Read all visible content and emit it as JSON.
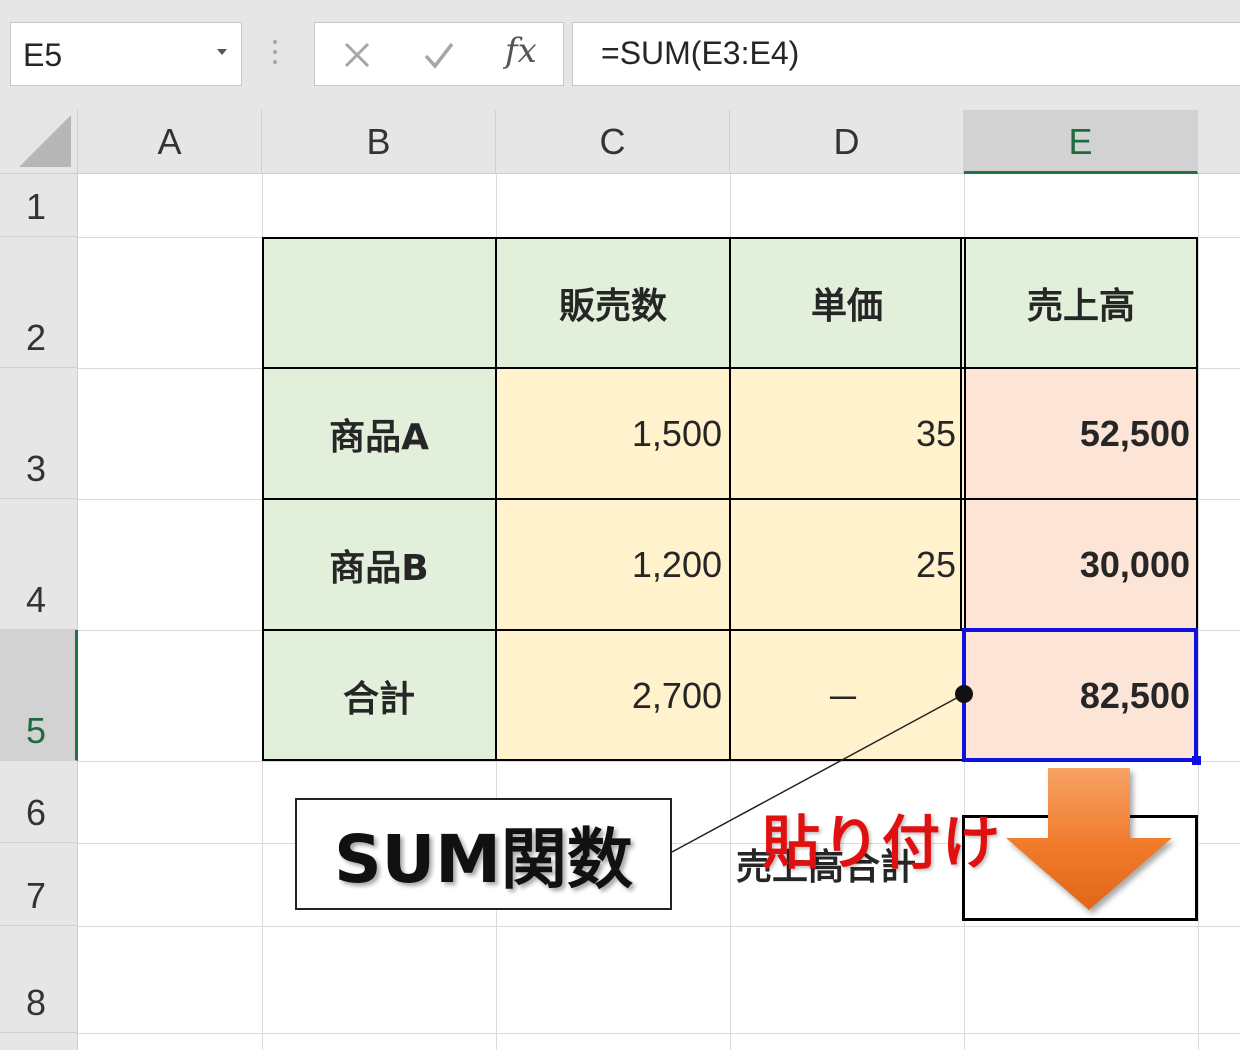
{
  "formula_bar": {
    "name_box": "E5",
    "cancel_icon": "x-icon",
    "enter_icon": "check-icon",
    "fx_label": "fx",
    "formula": "=SUM(E3:E4)"
  },
  "grid": {
    "selected_cell": "E5",
    "columns": [
      "A",
      "B",
      "C",
      "D",
      "E"
    ],
    "rows": [
      "1",
      "2",
      "3",
      "4",
      "5",
      "6",
      "7",
      "8"
    ]
  },
  "table": {
    "headers": [
      "販売数",
      "単価",
      "売上高"
    ],
    "rows": [
      {
        "label": "商品A",
        "qty": "1,500",
        "price": "35",
        "sales": "52,500"
      },
      {
        "label": "商品B",
        "qty": "1,200",
        "price": "25",
        "sales": "30,000"
      },
      {
        "label": "合計",
        "qty": "2,700",
        "price": "－",
        "sales": "82,500"
      }
    ],
    "total_sales_label": "売上高合計",
    "colors": {
      "header": "#e2efda",
      "input": "#fff2cc",
      "result": "#fce4d6",
      "selection": "#1010e0"
    }
  },
  "annotations": {
    "callout": "SUM関数",
    "paste_label": "貼り付け",
    "arrow_icon": "down-arrow-icon",
    "arrow_color": "#f07a2a",
    "paste_color": "#e01010"
  }
}
